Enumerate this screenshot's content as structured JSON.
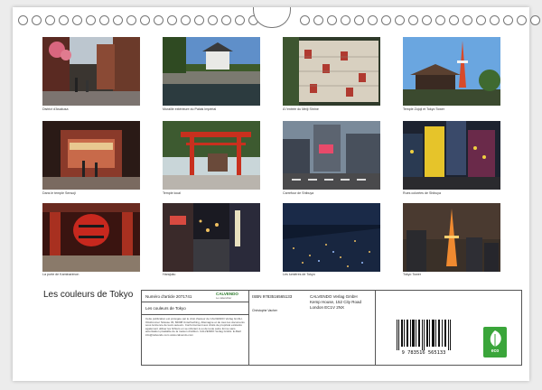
{
  "calendar": {
    "title": "Les couleurs de Tokyo",
    "photos": [
      {
        "caption": "District d'Asakusa"
      },
      {
        "caption": "Muraille extérieure du Palais Impérial"
      },
      {
        "caption": "À l'entrée du Meiji Shrine"
      },
      {
        "caption": "Temple Zojoji et Tokyo Tower"
      },
      {
        "caption": "Dans le temple Sensoji"
      },
      {
        "caption": "Temple local"
      },
      {
        "caption": "Carrefour de Shibuya"
      },
      {
        "caption": "Rues colorées de Shibuya"
      },
      {
        "caption": "La porte de Kaminarimon"
      },
      {
        "caption": "Harajuku"
      },
      {
        "caption": "Les lumières de Tokyo"
      },
      {
        "caption": "Tokyo Tower"
      }
    ]
  },
  "info": {
    "article_label": "Numéro d'article 2071741",
    "brand": "CALVENDO",
    "brand_sub": "Le calendrier",
    "isbn": "ISBN 9783516565133",
    "publisher": "CALVENDO Verlag GmbH",
    "address1": "Kemp House, 152 City Road",
    "address2": "London EC1V 2NX",
    "product_title": "Les couleurs de Tokyo",
    "author": "Christophe Vacher",
    "legal_text": "Cette publication est protégée par le droit d'auteur de CALVENDO Verlag GmbH, Ottobrunner Strasse 33, 82008 Unterhaching, Allemagne et de tous les documents sous la licence de leurs auteurs. Conformément aux droits de propriété existants également utiliser les fichiers en se référant à ou de toute autre forme sans autorisation préalable de la maison d'édition. CALVENDO Verlag GmbH. E-Mail: info@calvendo.com www.calvendo.com",
    "barcode_digits": "9 783516 565133",
    "eco_label": "eco"
  }
}
